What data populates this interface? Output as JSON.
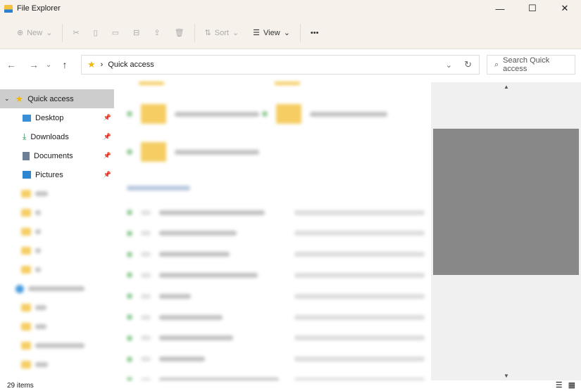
{
  "window": {
    "title": "File Explorer",
    "minimize": "—",
    "maximize": "☐",
    "close": "✕"
  },
  "toolbar": {
    "new": "New",
    "sort": "Sort",
    "view": "View",
    "more": "•••"
  },
  "nav": {
    "back": "←",
    "forward": "→",
    "recent": "⌄",
    "up": "↑"
  },
  "address": {
    "separator": "›",
    "location": "Quick access",
    "dropdown": "⌄",
    "refresh": "↻"
  },
  "search": {
    "placeholder": "Search Quick access"
  },
  "sidebar": {
    "quick_access": "Quick access",
    "items": [
      {
        "label": "Desktop"
      },
      {
        "label": "Downloads"
      },
      {
        "label": "Documents"
      },
      {
        "label": "Pictures"
      }
    ]
  },
  "status": {
    "items": "29 items"
  },
  "colors": {
    "accent": "#f5cd63",
    "selected": "#cdcdcd",
    "thumb": "#888888"
  }
}
